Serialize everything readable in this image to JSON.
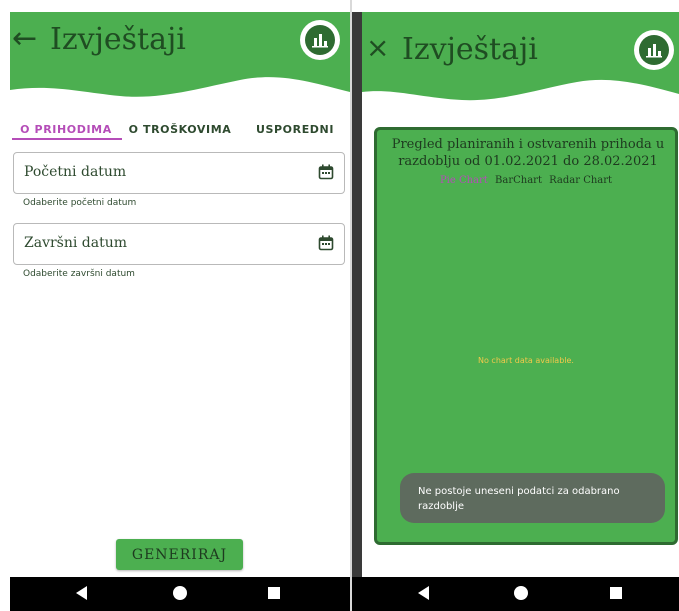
{
  "left": {
    "title": "Izvještaji",
    "back_icon": "←",
    "report_icon": "bar-chart-icon",
    "tabs": [
      {
        "label": "O PRIHODIMA",
        "active": true
      },
      {
        "label": "O TROŠKOVIMA",
        "active": false
      },
      {
        "label": "USPOREDNI",
        "active": false
      }
    ],
    "start_field": {
      "label": "Početni datum",
      "helper": "Odaberite početni datum"
    },
    "end_field": {
      "label": "Završni datum",
      "helper": "Odaberite završni datum"
    },
    "generate_label": "GENERIRAJ"
  },
  "right": {
    "title": "Izvještaji",
    "close_icon": "×",
    "report_icon": "bar-chart-icon",
    "dialog": {
      "title": "Pregled planiranih i ostvarenih prihoda u razdoblju od 01.02.2021 do 28.02.2021",
      "chart_tabs": [
        "Pie Chart",
        "BarChart",
        "Radar Chart"
      ],
      "selected_chart_tab": "Pie Chart",
      "empty_message": "No chart data available."
    },
    "toast": "Ne postoje uneseni podatci za odabrano razdoblje"
  },
  "colors": {
    "primary_green": "#4caf50",
    "dark_green": "#2e6b31",
    "accent_purple": "#b54db8",
    "empty_text_yellow": "#f2c84b",
    "toast_bg": "#5e6b5e"
  },
  "navbar_icons": [
    "back-triangle-icon",
    "home-circle-icon",
    "recents-square-icon"
  ]
}
